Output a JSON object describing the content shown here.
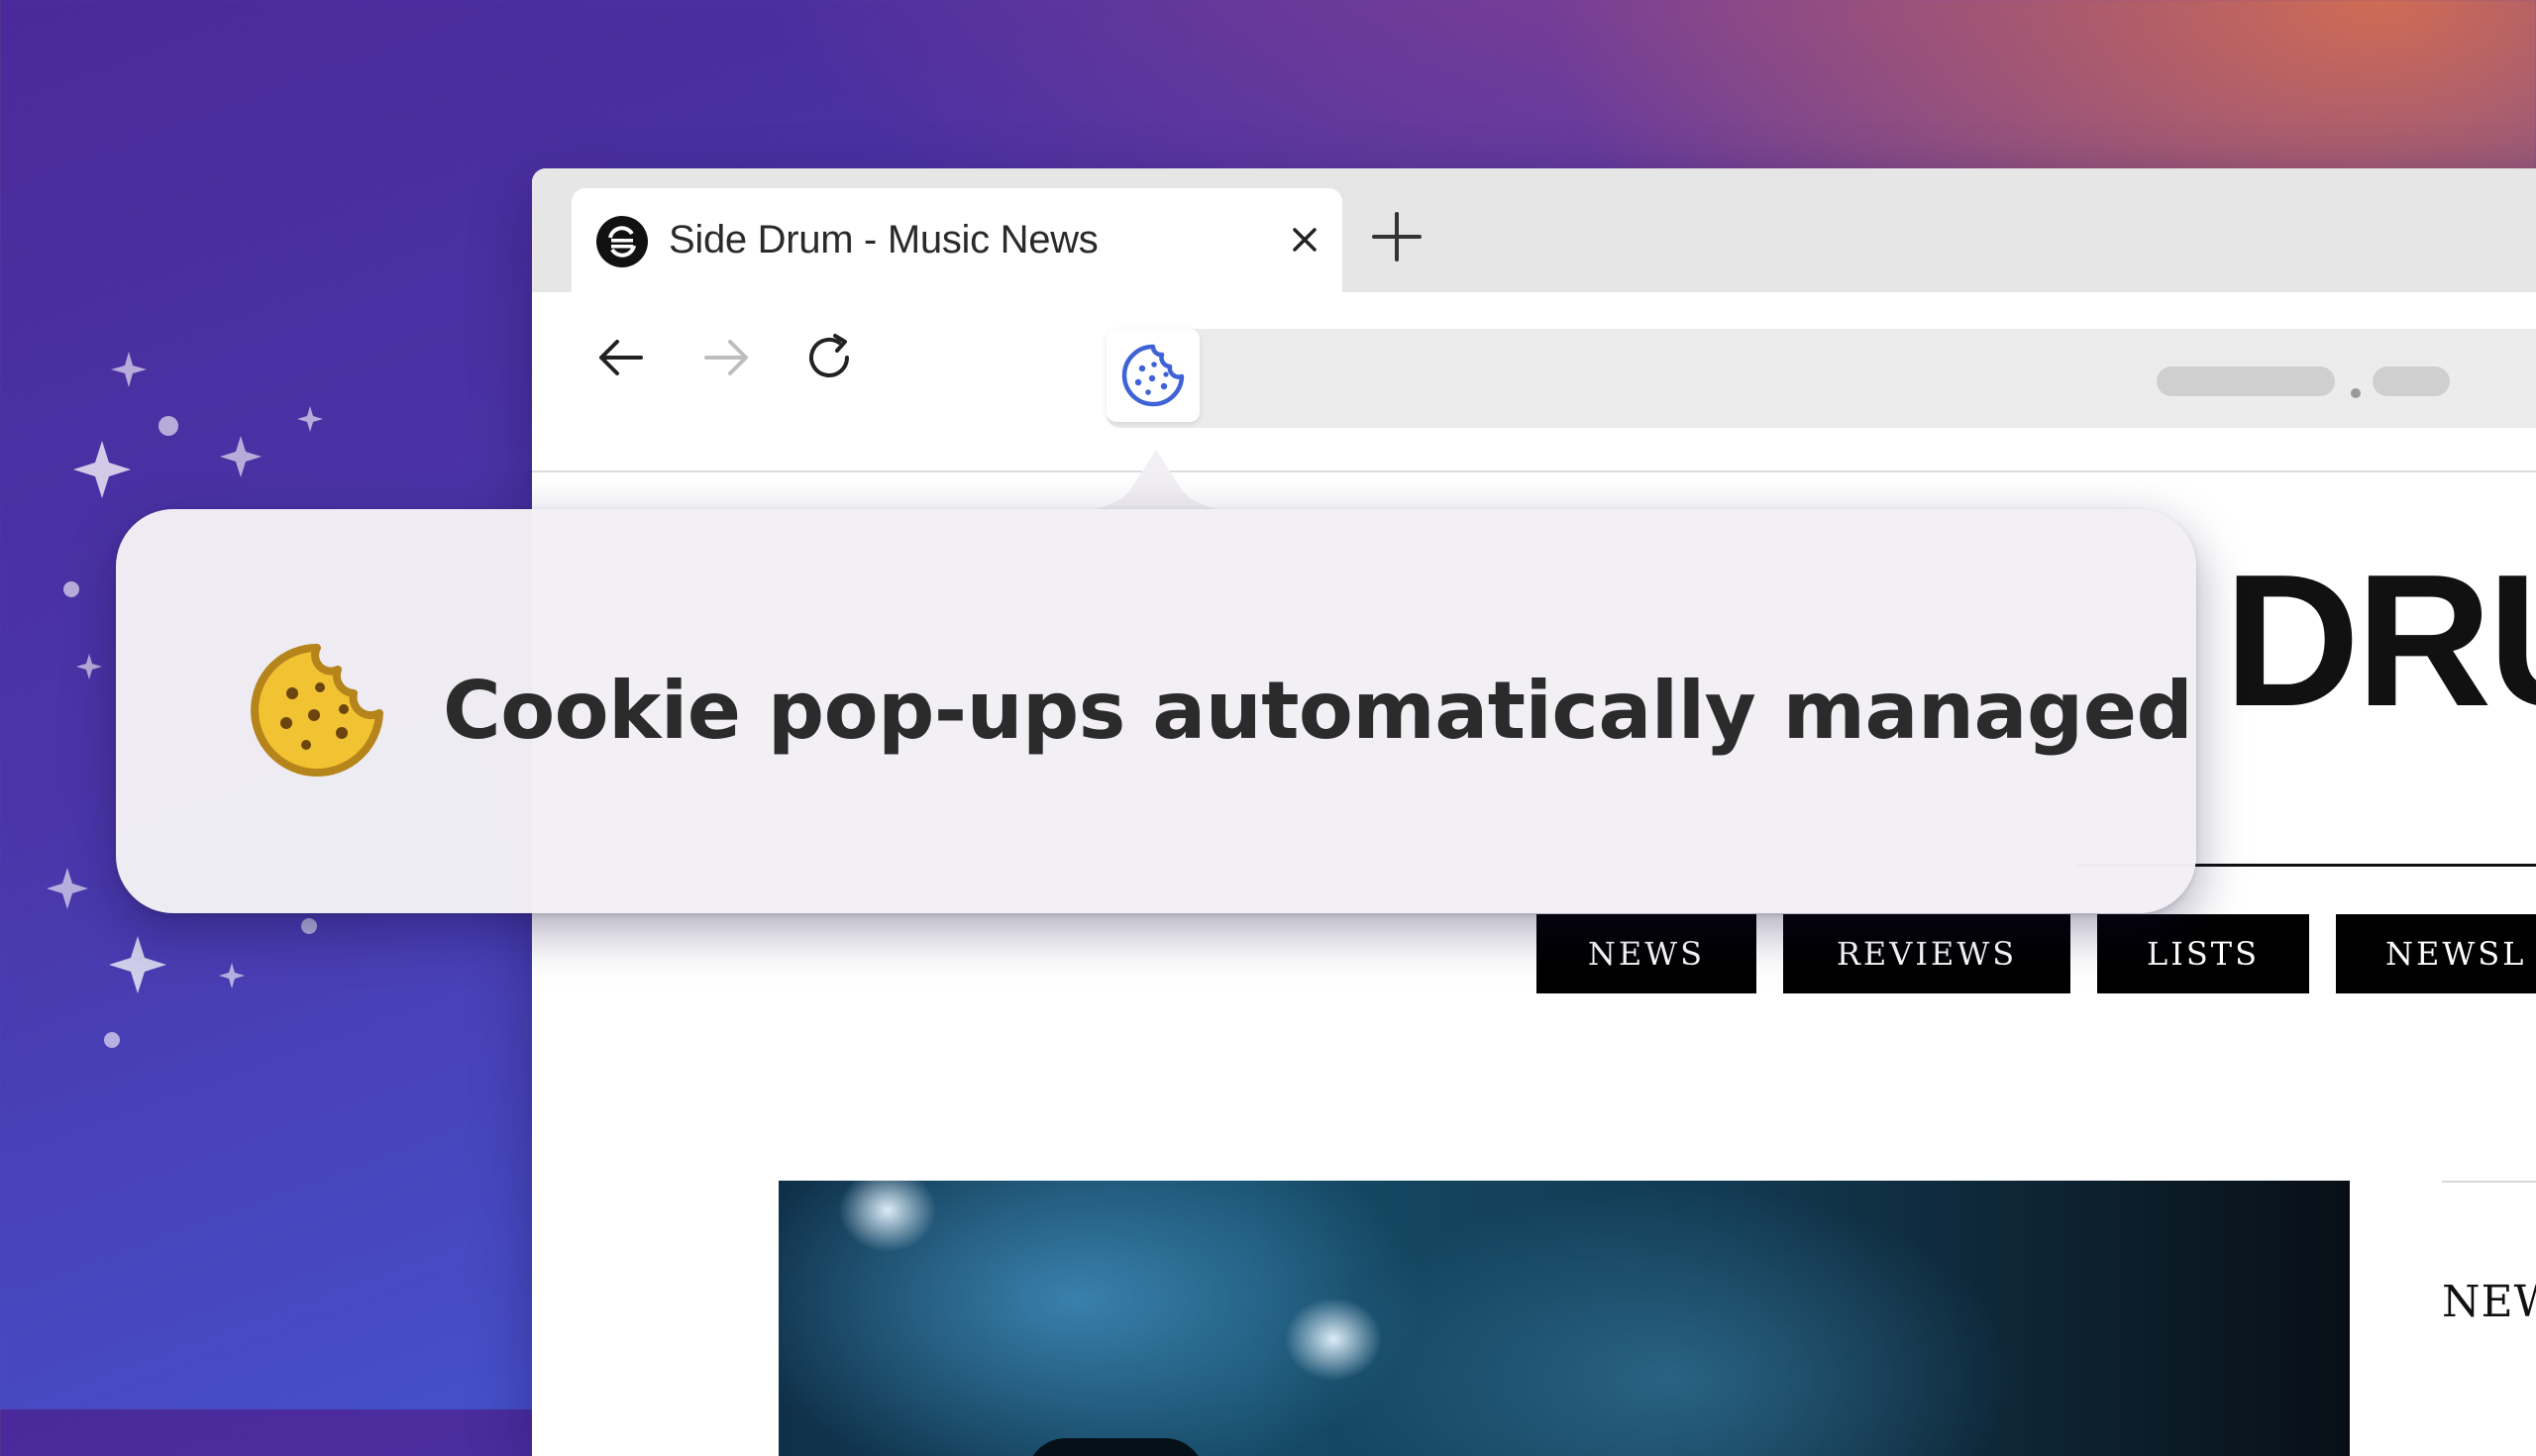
{
  "browser": {
    "tab": {
      "title": "Side Drum - Music News",
      "favicon": "site-logo-icon"
    },
    "toolbar": {
      "back": "arrow-left-icon",
      "forward": "arrow-right-icon",
      "reload": "reload-icon",
      "extension": "cookie-icon"
    }
  },
  "site": {
    "logo_partial": "DRU",
    "nav": [
      "NEWS",
      "REVIEWS",
      "LISTS",
      "NEWSL"
    ],
    "sidebar_heading_partial": "NEW"
  },
  "popover": {
    "message": "Cookie pop-ups automatically managed",
    "icon": "cookie-icon"
  },
  "colors": {
    "accent_blue": "#3f63d6",
    "cookie_yellow": "#f1c232",
    "cookie_outline": "#b5841a"
  }
}
